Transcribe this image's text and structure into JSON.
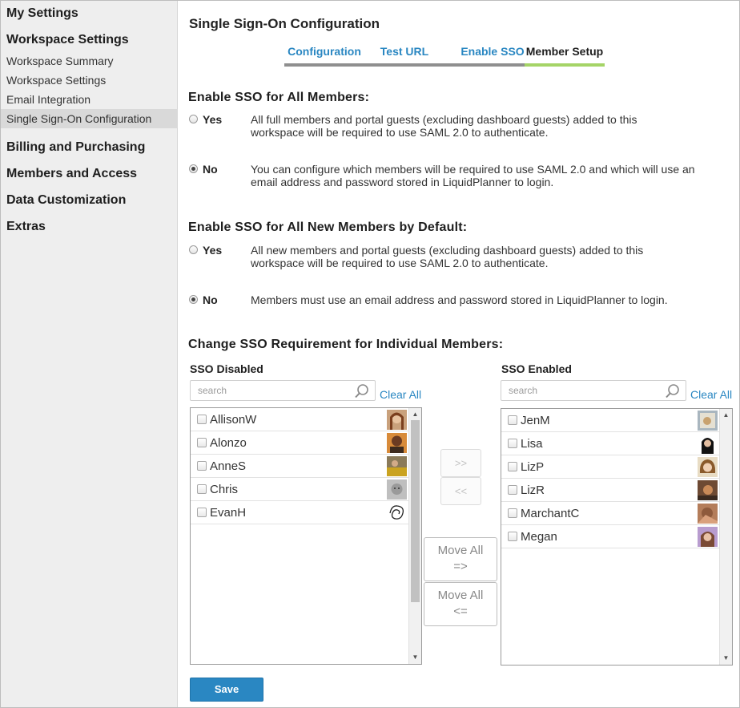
{
  "sidebar": {
    "my_settings": "My Settings",
    "workspace_settings": "Workspace Settings",
    "items": [
      {
        "label": "Workspace Summary"
      },
      {
        "label": "Workspace Settings"
      },
      {
        "label": "Email Integration"
      },
      {
        "label": "Single Sign-On Configuration"
      }
    ],
    "sections": [
      {
        "label": "Billing and Purchasing"
      },
      {
        "label": "Members and Access"
      },
      {
        "label": "Data Customization"
      },
      {
        "label": "Extras"
      }
    ]
  },
  "main": {
    "title": "Single Sign-On Configuration",
    "tabs": [
      {
        "label": "Configuration"
      },
      {
        "label": "Test URL"
      },
      {
        "label": "Enable SSO"
      },
      {
        "label": "Member Setup"
      }
    ],
    "active_tab": "Member Setup",
    "accent_color": "#2a87c2",
    "active_tab_color": "#a5d467"
  },
  "all_members": {
    "title": "Enable SSO for All Members:",
    "yes_label": "Yes",
    "yes_desc": "All full members and portal guests (excluding dashboard guests) added to this workspace will be required to use SAML 2.0 to authenticate.",
    "no_label": "No",
    "no_desc": "You can configure which members will be required to use SAML 2.0 and which will use an email address and password stored in LiquidPlanner to login.",
    "selected": "No"
  },
  "new_members": {
    "title": "Enable SSO for All New Members by Default:",
    "yes_label": "Yes",
    "yes_desc": "All new members and portal guests (excluding dashboard guests) added to this workspace will be required to use SAML 2.0 to authenticate.",
    "no_label": "No",
    "no_desc": "Members must use an email address and password stored in LiquidPlanner to login.",
    "selected": "No"
  },
  "individual": {
    "title": "Change SSO Requirement for Individual Members:",
    "disabled": {
      "title": "SSO Disabled",
      "search_placeholder": "search",
      "clear_all": "Clear All",
      "members": [
        {
          "name": "AllisonW"
        },
        {
          "name": "Alonzo"
        },
        {
          "name": "AnneS"
        },
        {
          "name": "Chris"
        },
        {
          "name": "EvanH"
        }
      ]
    },
    "enabled": {
      "title": "SSO Enabled",
      "search_placeholder": "search",
      "clear_all": "Clear All",
      "members": [
        {
          "name": "JenM"
        },
        {
          "name": "Lisa"
        },
        {
          "name": "LizP"
        },
        {
          "name": "LizR"
        },
        {
          "name": "MarchantC"
        },
        {
          "name": "Megan"
        }
      ]
    },
    "move_right": ">>",
    "move_left": "<<",
    "move_all_right": {
      "line1": "Move All",
      "line2": "=>"
    },
    "move_all_left": {
      "line1": "Move All",
      "line2": "<="
    }
  },
  "save_label": "Save"
}
